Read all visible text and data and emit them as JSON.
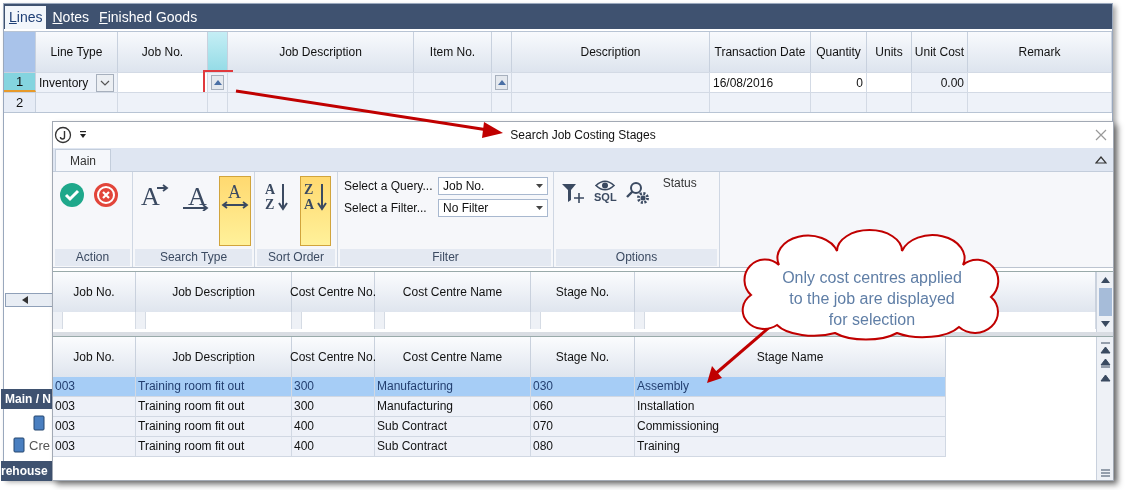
{
  "tabs": [
    {
      "label": "Lines",
      "selected": true
    },
    {
      "label": "Notes",
      "selected": false
    },
    {
      "label": "Finished Goods",
      "selected": false
    }
  ],
  "lines_grid": {
    "columns": [
      {
        "label": "Line Type",
        "kind": "dropdown",
        "editable": false,
        "current": false
      },
      {
        "label": "Job No.",
        "kind": "text",
        "editable": true,
        "current": false
      },
      {
        "kind": "lookup",
        "editable": false,
        "current": true
      },
      {
        "label": "Job Description",
        "kind": "text",
        "editable": false,
        "current": false
      },
      {
        "label": "Item No.",
        "kind": "text",
        "editable": false,
        "current": false
      },
      {
        "kind": "lookup",
        "editable": false,
        "current": false
      },
      {
        "label": "Description",
        "kind": "text",
        "editable": false,
        "current": false
      },
      {
        "label": "Transaction Date",
        "kind": "text",
        "editable": true,
        "current": false
      },
      {
        "label": "Quantity",
        "kind": "number",
        "editable": true,
        "current": false
      },
      {
        "label": "Units",
        "kind": "text",
        "editable": true,
        "current": false
      },
      {
        "label": "Unit Cost",
        "kind": "number",
        "editable": false,
        "current": false
      },
      {
        "label": "Remark",
        "kind": "text",
        "editable": true,
        "current": false
      }
    ],
    "rows": [
      {
        "number": "1",
        "current": true,
        "cells": [
          "Inventory",
          null,
          null,
          null,
          null,
          null,
          null,
          "16/08/2016",
          "0",
          null,
          "0.00",
          null
        ]
      },
      {
        "number": "2",
        "current": false,
        "cells": [
          null,
          null,
          null,
          null,
          null,
          null,
          null,
          null,
          null,
          null,
          null,
          null
        ]
      }
    ]
  },
  "side_panel": {
    "header": "Main / N",
    "item": "Cre",
    "footer": "rehouse"
  },
  "dialog": {
    "title": "Search Job Costing Stages",
    "ribbon_tabs": [
      {
        "label": "Main",
        "selected": true
      }
    ],
    "groups": [
      {
        "label": "Action",
        "kind": "buttons",
        "buttons": [
          {
            "kind": "accept"
          },
          {
            "kind": "cancel"
          }
        ]
      },
      {
        "label": "Search Type",
        "kind": "buttons",
        "buttons": [
          {
            "kind": "starts_with",
            "glyph": "A",
            "selected": false
          },
          {
            "kind": "exact",
            "glyph": "A",
            "selected": false
          },
          {
            "kind": "contains",
            "glyph": "A",
            "selected": true
          }
        ]
      },
      {
        "label": "Sort Order",
        "kind": "buttons",
        "buttons": [
          {
            "kind": "ascending",
            "glyphs": [
              "A",
              "Z"
            ],
            "selected": false
          },
          {
            "kind": "descending",
            "glyphs": [
              "Z",
              "A"
            ],
            "selected": true
          }
        ]
      },
      {
        "label": "Filter",
        "kind": "fields",
        "fields": [
          {
            "label": "Select a Query...",
            "value": "Job No."
          },
          {
            "label": "Select a Filter...",
            "value": "No Filter"
          }
        ]
      },
      {
        "label": "Options",
        "kind": "buttons",
        "buttons": [
          {
            "kind": "add_filter"
          },
          {
            "kind": "sql",
            "glyph": "SQL"
          },
          {
            "kind": "search_settings"
          },
          {
            "kind": "status",
            "label": "Status"
          }
        ]
      }
    ],
    "filter_grid": {
      "columns": [
        "Job No.",
        "Job Description",
        "Cost Centre No.",
        "Cost Centre Name",
        "Stage No."
      ]
    },
    "results_grid": {
      "columns": [
        "Job No.",
        "Job Description",
        "Cost Centre No.",
        "Cost Centre Name",
        "Stage No.",
        "Stage Name"
      ],
      "rows": [
        {
          "selected": true,
          "cells": [
            "003",
            "Training room fit out",
            "300",
            "Manufacturing",
            "030",
            "Assembly"
          ]
        },
        {
          "selected": false,
          "cells": [
            "003",
            "Training room fit out",
            "300",
            "Manufacturing",
            "060",
            "Installation"
          ]
        },
        {
          "selected": false,
          "cells": [
            "003",
            "Training room fit out",
            "400",
            "Sub Contract",
            "070",
            "Commissioning"
          ]
        },
        {
          "selected": false,
          "cells": [
            "003",
            "Training room fit out",
            "400",
            "Sub Contract",
            "080",
            "Training"
          ]
        }
      ]
    }
  },
  "callout": {
    "text": "Only cost centres applied to the job are displayed for selection"
  }
}
